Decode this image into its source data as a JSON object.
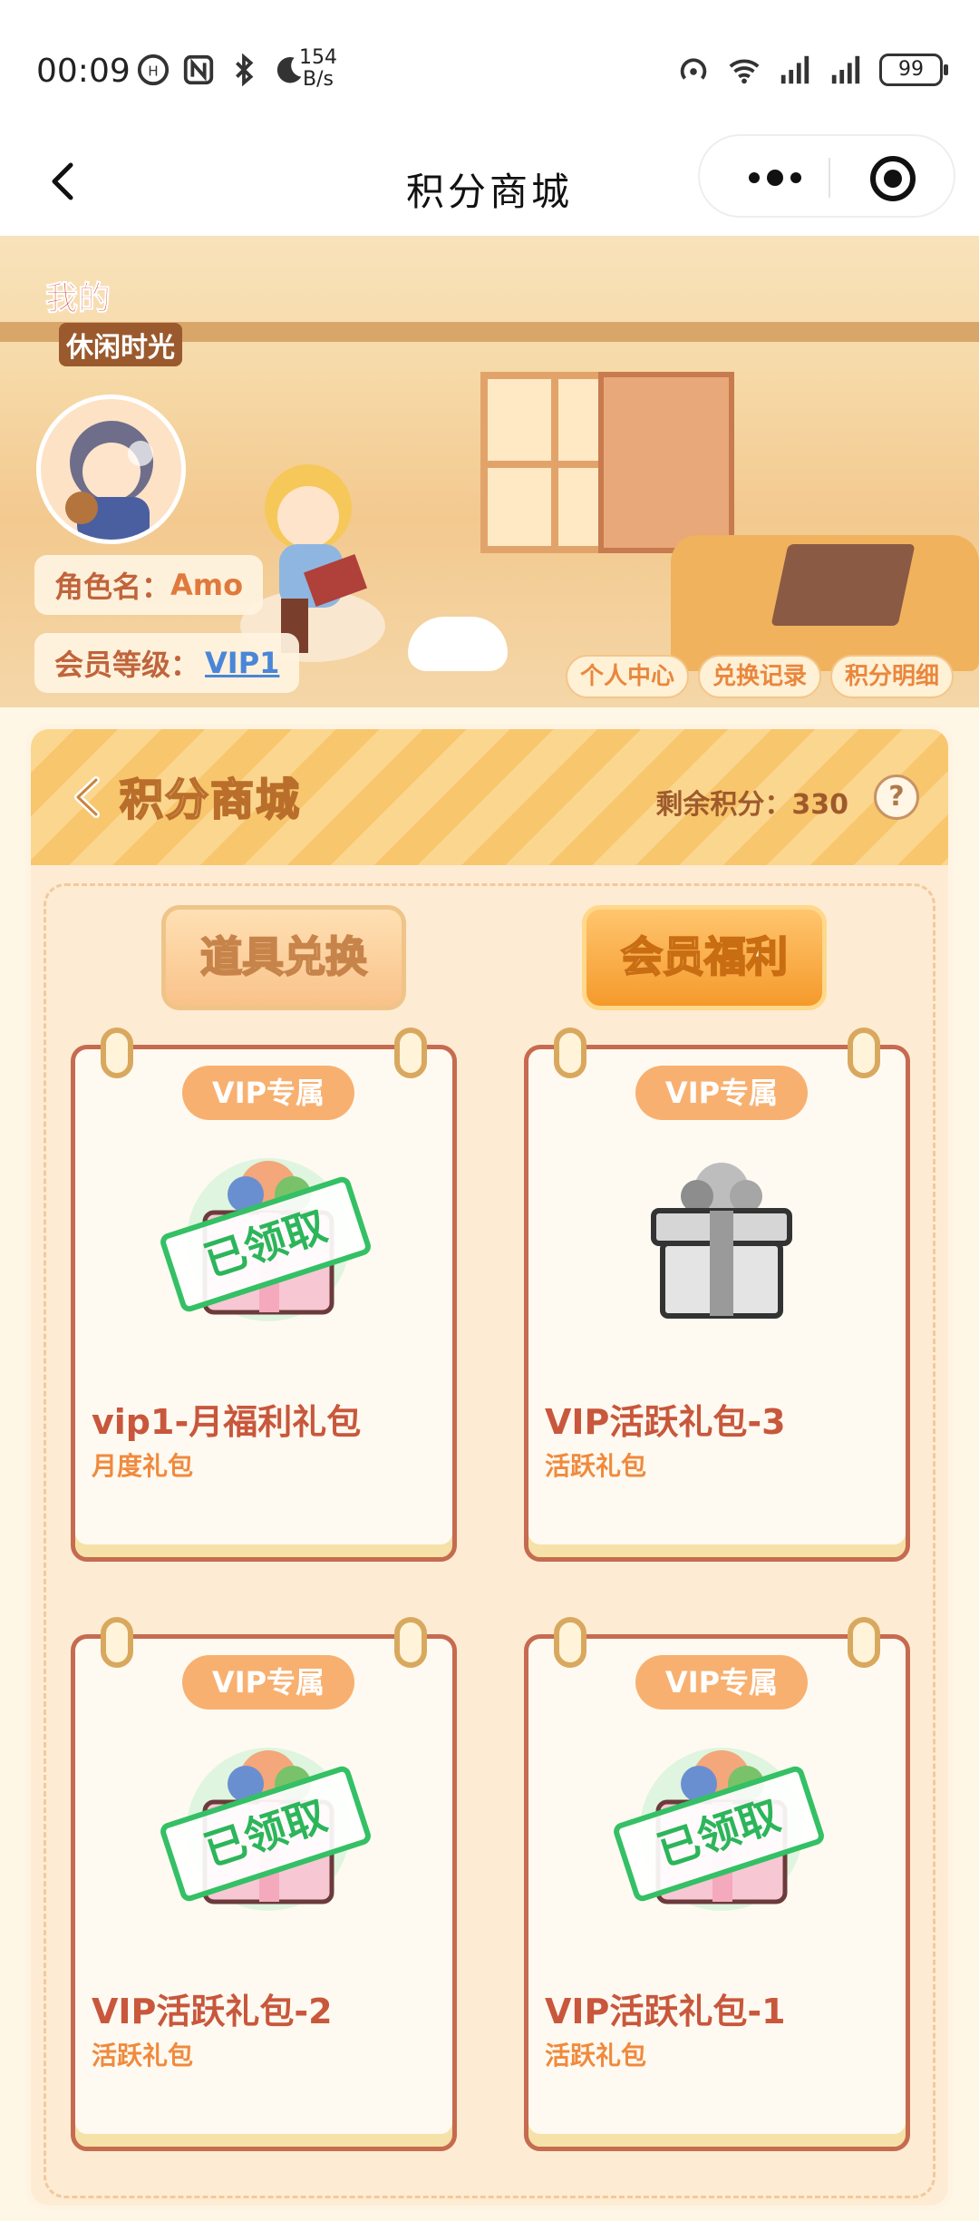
{
  "status_bar": {
    "time": "00:09",
    "net_speed_value": "154",
    "net_speed_unit": "B/s",
    "battery": "99",
    "left_icons": [
      "hd-icon",
      "nfc-icon",
      "bluetooth-icon",
      "moon-icon"
    ],
    "right_icons": [
      "hotspot-icon",
      "wifi-icon",
      "signal-icon",
      "signal-icon"
    ]
  },
  "nav": {
    "title": "积分商城"
  },
  "banner": {
    "logo_line1": "我的",
    "logo_line2": "休闲时光",
    "role_label": "角色名：",
    "role_value": "Amo",
    "level_label": "会员等级：",
    "level_value": "VIP1",
    "buttons": [
      "个人中心",
      "兑换记录",
      "积分明细"
    ]
  },
  "panel": {
    "title": "积分商城",
    "points_label": "剩余积分：",
    "points_value": "330",
    "help": "?",
    "tabs": [
      "道具兑换",
      "会员福利"
    ],
    "active_tab": "会员福利"
  },
  "cards": [
    {
      "badge": "VIP专属",
      "name": "vip1-月福利礼包",
      "type": "月度礼包",
      "claimed": true,
      "stamp": "已领取"
    },
    {
      "badge": "VIP专属",
      "name": "VIP活跃礼包-3",
      "type": "活跃礼包",
      "claimed": false,
      "stamp": ""
    },
    {
      "badge": "VIP专属",
      "name": "VIP活跃礼包-2",
      "type": "活跃礼包",
      "claimed": true,
      "stamp": "已领取"
    },
    {
      "badge": "VIP专属",
      "name": "VIP活跃礼包-1",
      "type": "活跃礼包",
      "claimed": true,
      "stamp": "已领取"
    }
  ],
  "colors": {
    "accent_orange": "#f59a2c",
    "card_border": "#c66b50",
    "stamp_green": "#2cb55a",
    "vip_link": "#4a86d8"
  }
}
